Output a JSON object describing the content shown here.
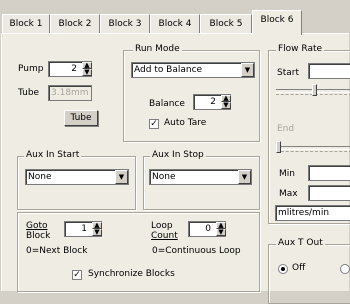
{
  "tabs": [
    "Block 1",
    "Block 2",
    "Block 3",
    "Block 4",
    "Block 5",
    "Block 6"
  ],
  "selected_tab": "Block 6",
  "pump": {
    "label": "Pump",
    "value": "2"
  },
  "tube": {
    "label": "Tube",
    "value": "3.18mm",
    "button_label": "Tube"
  },
  "run_mode": {
    "title": "Run Mode",
    "value": "Add to Balance"
  },
  "balance": {
    "label": "Balance",
    "value": "2",
    "auto_tare_label": "Auto Tare",
    "auto_tare_checked": true
  },
  "aux_in_start": {
    "title": "Aux In Start",
    "value": "None"
  },
  "aux_in_stop": {
    "title": "Aux In Stop",
    "value": "None"
  },
  "goto_block": {
    "label_line1": "Goto",
    "label_line2": "Block",
    "value": "1",
    "hint": "0=Next Block"
  },
  "loop_count": {
    "label_line1": "Loop",
    "label_line2": "Count",
    "value": "0",
    "hint": "0=Continuous Loop"
  },
  "synchronize": {
    "label": "Synchronize Blocks",
    "checked": true
  },
  "flow_rate": {
    "title": "Flow Rate",
    "start_label": "Start",
    "end_label": "End",
    "min_label": "Min",
    "max_label": "Max",
    "units": "mlitres/min"
  },
  "aux_out": {
    "title": "Aux T Out",
    "off_label": "Off",
    "off_selected": true
  }
}
